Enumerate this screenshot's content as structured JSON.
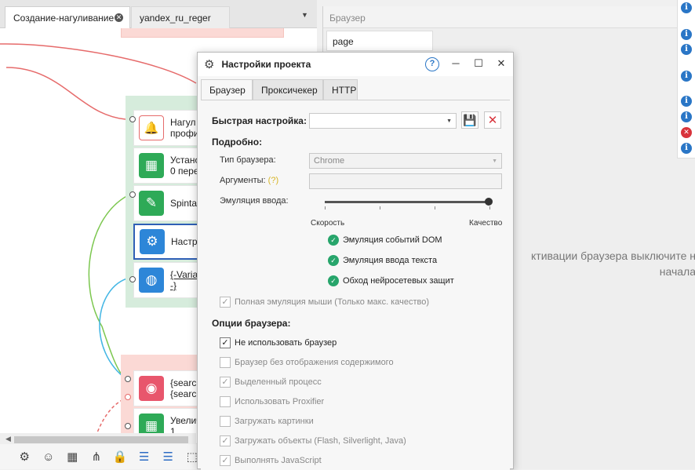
{
  "tabs": {
    "active": "Создание-нагуливание",
    "inactive": "yandex_ru_reger"
  },
  "canvas": {
    "nodes": [
      {
        "text": "Нагул\nпрофи",
        "icon": "bell-icon",
        "color": "#ffffff",
        "glyph": "🔔",
        "link": false
      },
      {
        "text": "Устано\n0 пере",
        "icon": "grid-icon",
        "color": "#2eaa57",
        "glyph": "▦",
        "link": false
      },
      {
        "text": "Spintax",
        "icon": "pencil-icon",
        "color": "#2eaa57",
        "glyph": "✎",
        "link": false
      },
      {
        "text": "Настро",
        "icon": "gear-icon",
        "color": "#2d86d8",
        "glyph": "⚙",
        "link": false
      },
      {
        "text": "{-Varia\n-}",
        "icon": "globe-icon",
        "color": "#2d86d8",
        "glyph": "🌐",
        "link": true
      },
      {
        "text": "{search\n{search",
        "icon": "toggle-icon",
        "color": "#e8566c",
        "glyph": "◉",
        "link": false
      },
      {
        "text": "Увелич\n1",
        "icon": "grid-icon",
        "color": "#2eaa57",
        "glyph": "▦",
        "link": false
      }
    ]
  },
  "browser": {
    "title": "Браузер",
    "page_tab": "page",
    "message_line1": "ктивации браузера выключите н",
    "message_line2": "начала"
  },
  "dialog": {
    "title": "Настройки проекта",
    "tabs": [
      "Браузер",
      "Проксичекер",
      "HTTP"
    ],
    "quick_setting_label": "Быстрая настройка:",
    "quick_setting_value": "",
    "detailed_label": "Подробно:",
    "browser_type_label": "Тип браузера:",
    "browser_type_value": "Chrome",
    "args_label": "Аргументы:",
    "args_hint": "(?)",
    "args_value": "",
    "input_emulation_label": "Эмуляция ввода:",
    "slider_min": "Скорость",
    "slider_max": "Качество",
    "slider_value_percent": 100,
    "toggles": [
      "Эмуляция событий DOM",
      "Эмуляция ввода текста",
      "Обход нейросетевых защит"
    ],
    "full_mouse_label": "Полная эмуляция мыши (Только макс. качество)",
    "browser_options_label": "Опции браузера:",
    "options": [
      {
        "label": "Не использовать браузер",
        "checked": true,
        "enabled": true
      },
      {
        "label": "Браузер без отображения содержимого",
        "checked": false,
        "enabled": false
      },
      {
        "label": "Выделенный процесс",
        "checked": true,
        "enabled": false
      },
      {
        "label": "Использовать Proxifier",
        "checked": false,
        "enabled": false
      },
      {
        "label": "Загружать картинки",
        "checked": false,
        "enabled": false
      },
      {
        "label": "Загружать объекты (Flash, Silverlight, Java)",
        "checked": true,
        "enabled": false
      },
      {
        "label": "Выполнять JavaScript",
        "checked": true,
        "enabled": false
      }
    ]
  },
  "log_icons": [
    "info",
    "info",
    "info",
    "info",
    "info",
    "info",
    "error",
    "info"
  ]
}
